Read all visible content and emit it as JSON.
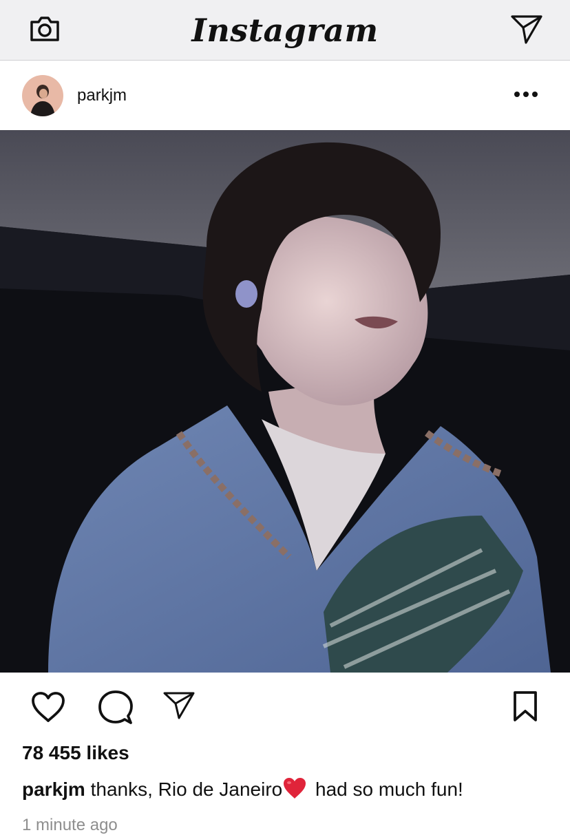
{
  "app": {
    "logo_text": "Instagram",
    "top_left_icon": "camera-icon",
    "top_right_icon": "direct-message-icon"
  },
  "post": {
    "username": "parkjm",
    "more_icon": "more-options-icon",
    "photo_description_icon": "post-photo",
    "actions": {
      "like_icon": "heart-outline-icon",
      "comment_icon": "comment-icon",
      "share_icon": "paper-plane-icon",
      "save_icon": "bookmark-icon"
    },
    "likes_text": "78 455 likes",
    "caption": {
      "username": "parkjm",
      "text_before": "thanks, Rio de Janeiro",
      "emoji_icon": "red-heart-emoji",
      "text_after": " had so much fun!"
    },
    "timestamp": "1 minute ago"
  },
  "colors": {
    "topbar_bg": "#f0f0f2",
    "text": "#111111",
    "muted": "#8e8e8e",
    "emoji_heart": "#e0243a"
  }
}
